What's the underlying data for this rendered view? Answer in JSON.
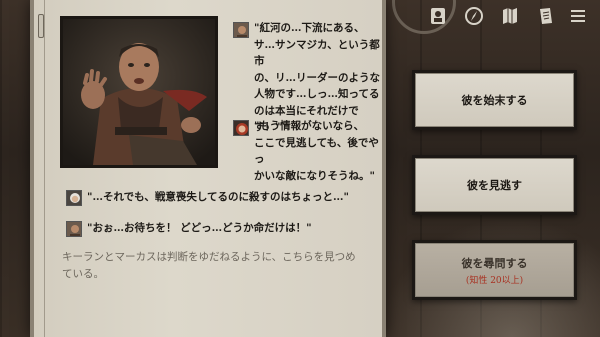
{
  "dialogue": [
    {
      "speaker_icon": "gangster-avatar",
      "text_lines": [
        "\"紅河の…下流にある、",
        "サ…サンマジカ、という都市",
        "の、リ…リーダーのような",
        "人物です…しっ…知ってる",
        "のは本当にそれだけです！\""
      ]
    },
    {
      "speaker_icon": "red-hair-woman-avatar",
      "text_lines": [
        "\"もう情報がないなら、",
        "ここで見逃しても、後でやっ",
        "かいな敵になりそうね。\""
      ]
    },
    {
      "speaker_icon": "white-hair-man-avatar",
      "text_lines": [
        "\"…それでも、戦意喪失してるのに殺すのはちょっと…\""
      ]
    },
    {
      "speaker_icon": "gangster-avatar",
      "text_lines": [
        "\"おぉ…お待ちを！ どどっ…どうか命だけは！\""
      ]
    }
  ],
  "narration_lines": [
    "キーランとマーカスは判断をゆだねるように、こちらを見つめ",
    "ている。"
  ],
  "choices": [
    {
      "label": "彼を始末する",
      "requirement": "",
      "locked": false
    },
    {
      "label": "彼を見逃す",
      "requirement": "",
      "locked": false
    },
    {
      "label": "彼を尋問する",
      "requirement": "(知性 20以上)",
      "locked": true
    }
  ],
  "top_icons": [
    "character-icon",
    "compass-icon",
    "map-icon",
    "journal-icon",
    "menu-icon"
  ],
  "colors": {
    "parchment": "#d8d2c5",
    "requirement_red": "#a83222",
    "text_dark": "#1d1a16",
    "narration_gray": "#6c665c"
  }
}
